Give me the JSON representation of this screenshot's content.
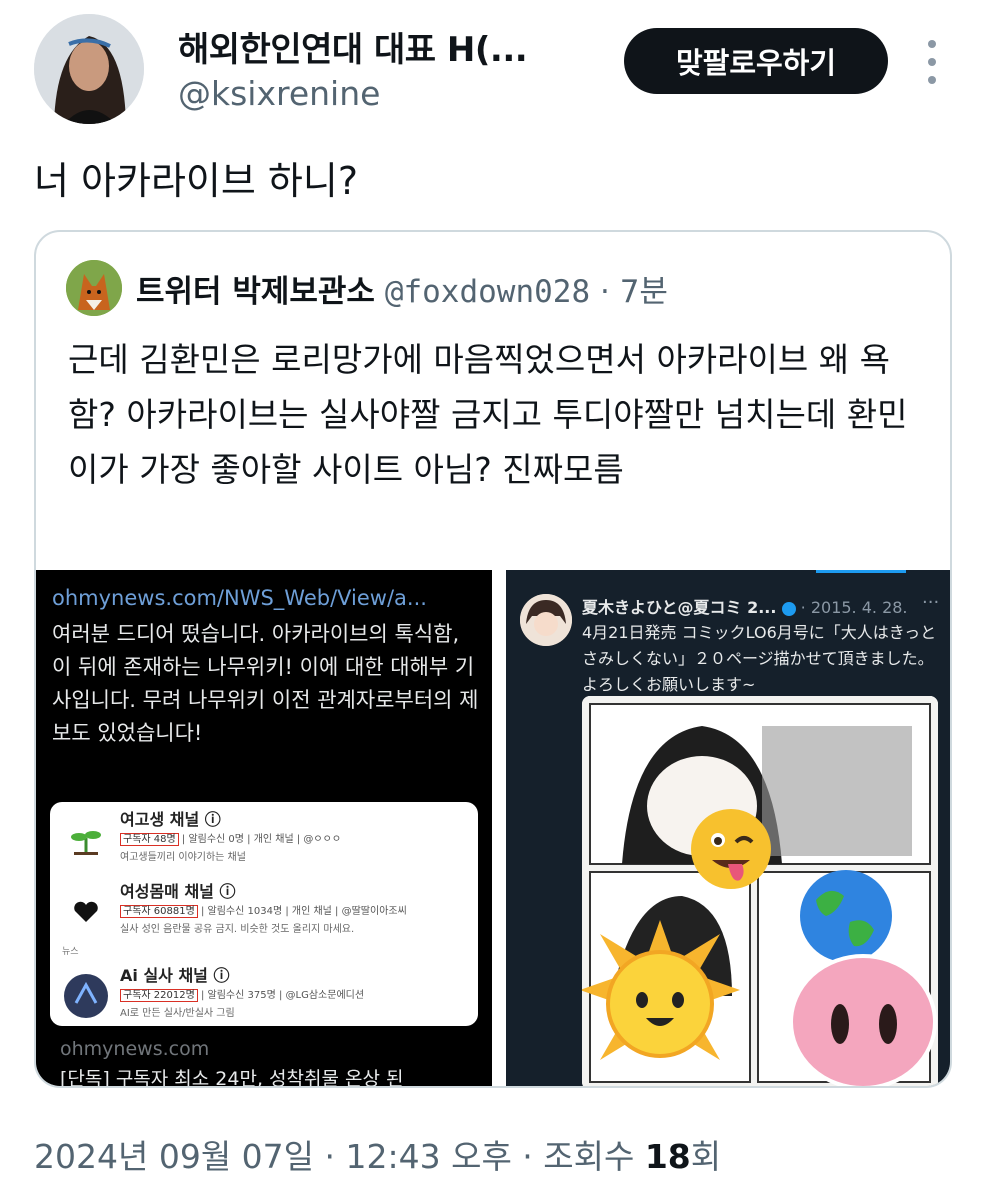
{
  "author": {
    "name": "해외한인연대 대표 H(...",
    "handle": "@ksixrenine",
    "follow_label": "맞팔로우하기"
  },
  "tweet": {
    "text": "너 아카라이브 하니?"
  },
  "quote": {
    "name": "트위터 박제보관소",
    "handle": "@foxdown028",
    "separator": "·",
    "time": "7분",
    "text": "근데 김환민은 로리망가에 마음찍었으면서 아카라이브 왜 욕함? 아카라이브는 실사야짤 금지고 투디야짤만 넘치는데 환민이가 가장 좋아할 사이트 아님? 진짜모름",
    "left_media": {
      "url": "ohmynews.com/NWS_Web/View/a...",
      "text": "여러분 드디어 떴습니다. 아카라이브의 톡식함, 이 뒤에 존재하는 나무위키! 이에 대한 대해부 기사입니다. 무려 나무위키 이전 관계자로부터의 제보도 있었습니다!",
      "channels": [
        {
          "title": "여고생 채널 ⓘ",
          "subscribers": "구독자 48명",
          "meta": "| 알림수신 0명 | 개인 채널 | @ㅇㅇㅇ",
          "desc": "여고생들끼리 이야기하는 채널"
        },
        {
          "title": "여성몸매 채널 ⓘ",
          "subscribers": "구독자 60881명",
          "meta": "| 알림수신 1034명 | 개인 채널 | @딸딸이아조씨",
          "desc": "실사 성인 음란물 공유 금지. 비슷한 것도 올리지 마세요."
        },
        {
          "title": "Ai 실사 채널 ⓘ",
          "subscribers": "구독자 22012명",
          "meta": "| 알림수신 375명 | @LG삼소문에디션",
          "desc": "AI로 만든 실사/반실사 그림"
        }
      ],
      "section_label": "뉴스",
      "domain": "ohmynews.com",
      "headline": "[단독] 구독자 최소 24만, 성착취물 온상 된"
    },
    "right_media": {
      "name": "夏木きよひと@夏コミ 2...",
      "date": "· 2015. 4. 28.",
      "more": "···",
      "text": "4月21日発売 コミックLO6月号に「大人はきっとさみしくない」２０ページ描かせて頂きました。よろしくお願いします~"
    }
  },
  "footer": {
    "date_time": "2024년 09월 07일 · 12:43 오후 · 조회수 ",
    "views": "18",
    "views_unit": "회"
  },
  "colors": {
    "text": "#0f1419",
    "secondary": "#536471",
    "border": "#cfd9de",
    "button_bg": "#0f1419",
    "link": "#6e9fd8"
  }
}
